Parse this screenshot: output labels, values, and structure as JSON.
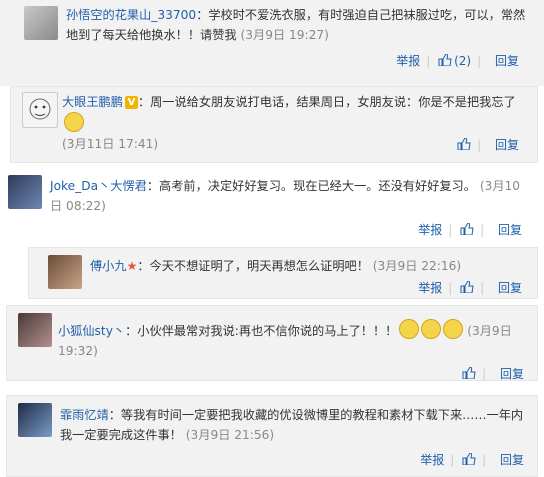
{
  "comments": [
    {
      "username": "孙悟空的花果山_33700",
      "text": "：学校时不爱洗衣服，有时强迫自己把袜服过吃，可以，常然地到了每天给他换水！！请赞我",
      "time": "(3月9日 19:27)",
      "actions": {
        "report": "举报",
        "likes": "(2)",
        "reply": "回复"
      }
    },
    {
      "username": "大眼王鹏鹏",
      "text": "：周一说给女朋友说打电话，结果周日，女朋友说：你是不是把我忘了",
      "time": "(3月11日 17:41)",
      "actions": {
        "reply": "回复"
      }
    },
    {
      "username": "Joke_Da丶大愣君",
      "text": "：高考前，决定好好复习。现在已经大一。还没有好好复习。",
      "time": "(3月10日 08:22)",
      "actions": {
        "report": "举报",
        "reply": "回复"
      }
    },
    {
      "username": "傅小九",
      "text": "：今天不想证明了，明天再想怎么证明吧！",
      "time": "(3月9日 22:16)",
      "actions": {
        "report": "举报",
        "reply": "回复"
      }
    },
    {
      "username": "小狐仙sty丶",
      "text": "：小伙伴最常对我说:再也不信你说的马上了！！！",
      "time": "(3月9日 19:32)",
      "actions": {
        "reply": "回复"
      }
    },
    {
      "username": "霏雨忆靖",
      "text": "：等我有时间一定要把我收藏的优设微博里的教程和素材下载下来……一年内我一定要完成这件事！",
      "time": "(3月9日 21:56)",
      "actions": {
        "report": "举报",
        "reply": "回复"
      }
    }
  ],
  "icons": {
    "thumbs_up": "thumbs-up-icon",
    "emoticon": "crying-face-icon",
    "vip": "v-badge-icon",
    "star": "star-icon"
  },
  "colors": {
    "link": "#1f5fa9",
    "time": "#888888",
    "background": "#f2f2f2"
  }
}
